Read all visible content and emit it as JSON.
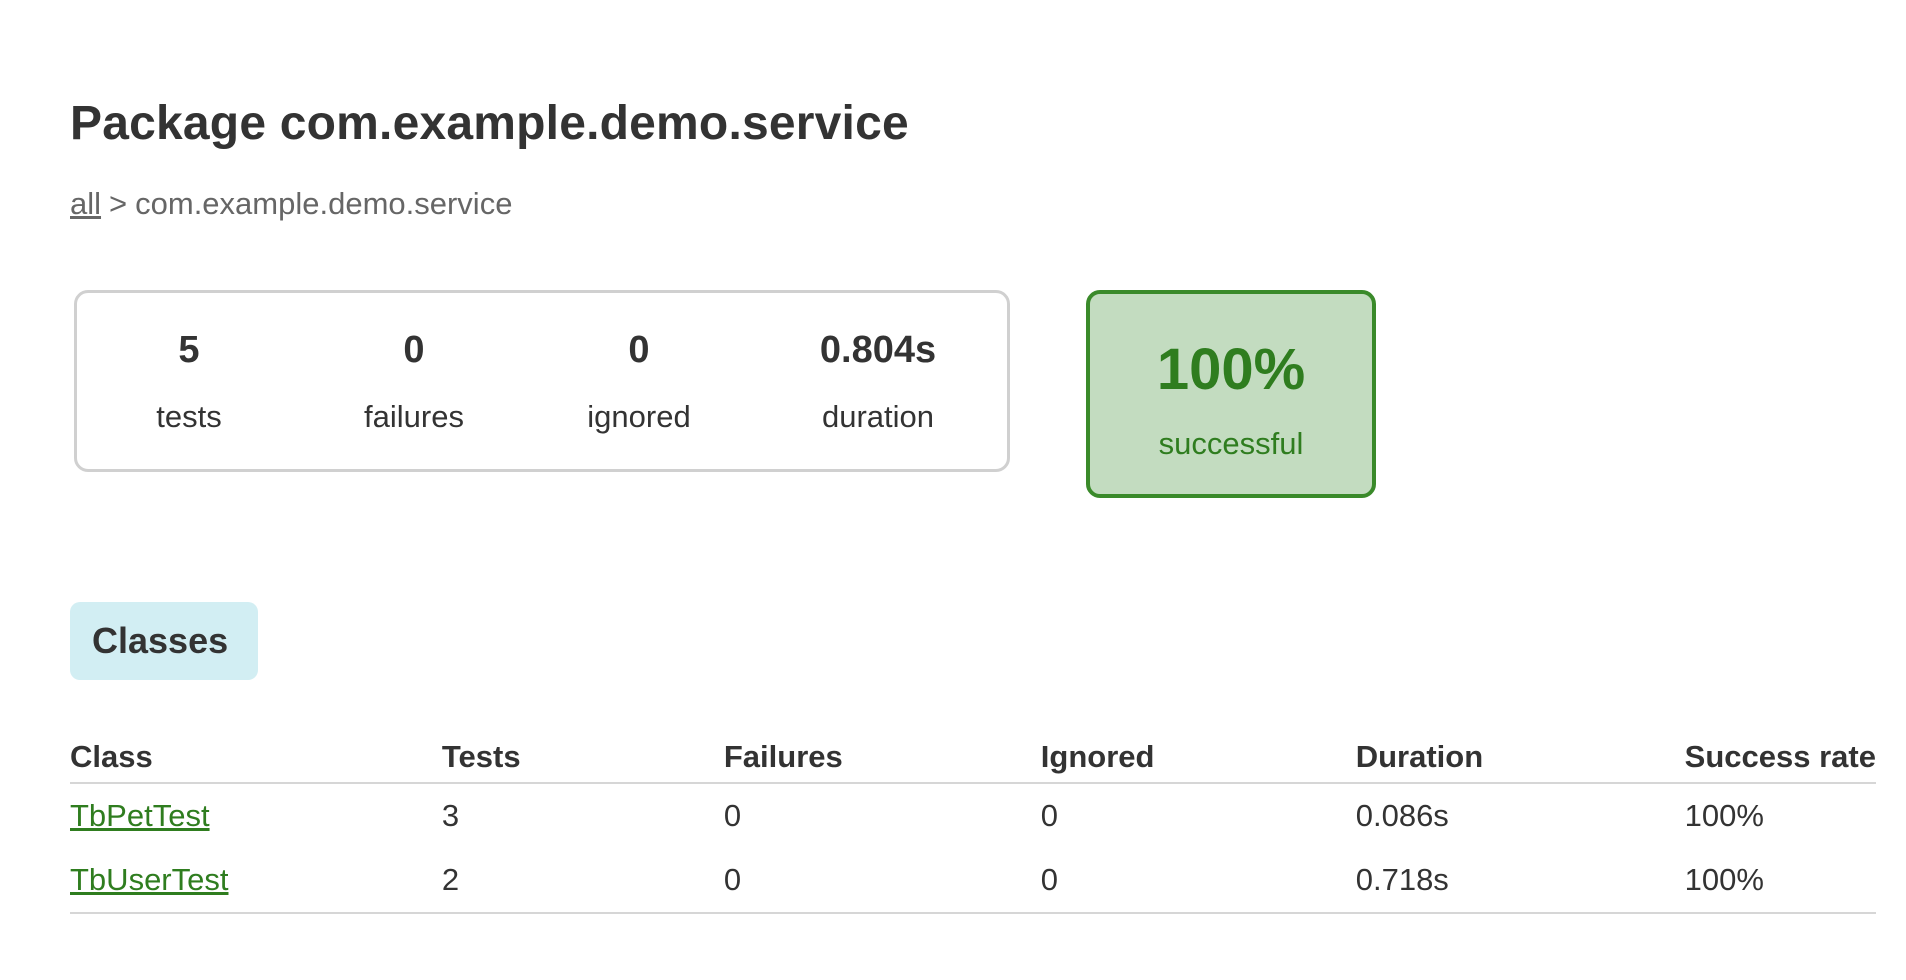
{
  "page": {
    "title": "Package com.example.demo.service"
  },
  "breadcrumb": {
    "root_link": "all",
    "separator": ">",
    "current": "com.example.demo.service"
  },
  "summary": {
    "tests": {
      "value": "5",
      "label": "tests"
    },
    "failures": {
      "value": "0",
      "label": "failures"
    },
    "ignored": {
      "value": "0",
      "label": "ignored"
    },
    "duration": {
      "value": "0.804s",
      "label": "duration"
    }
  },
  "success": {
    "rate": "100%",
    "label": "successful"
  },
  "tabs": {
    "classes_label": "Classes"
  },
  "table": {
    "headers": [
      "Class",
      "Tests",
      "Failures",
      "Ignored",
      "Duration",
      "Success rate"
    ],
    "rows": [
      {
        "class": "TbPetTest",
        "tests": "3",
        "failures": "0",
        "ignored": "0",
        "duration": "0.086s",
        "success_rate": "100%"
      },
      {
        "class": "TbUserTest",
        "tests": "2",
        "failures": "0",
        "ignored": "0",
        "duration": "0.718s",
        "success_rate": "100%"
      }
    ]
  },
  "colors": {
    "success_green": "#2f7d1f",
    "success_bg": "#c3dcc0",
    "tab_bg": "#d2eef3",
    "border_gray": "#d0d0d0"
  }
}
